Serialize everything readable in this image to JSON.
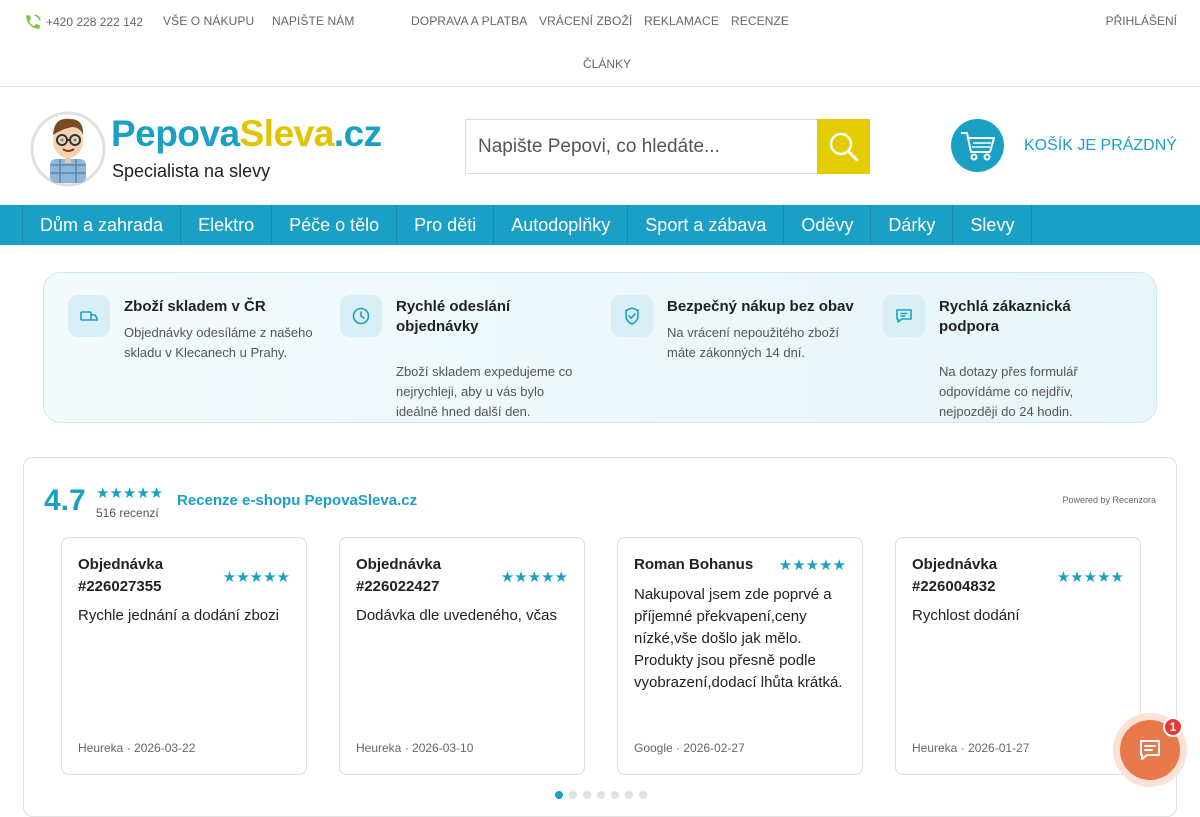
{
  "topbar": {
    "phone": "+420 228 222 142",
    "links": [
      "VŠE O NÁKUPU",
      "NAPIŠTE NÁM",
      "DOPRAVA A PLATBA",
      "VRÁCENÍ ZBOŽÍ",
      "REKLAMACE",
      "RECENZE",
      "ČLÁNKY"
    ],
    "login": "PŘIHLÁŠENÍ"
  },
  "logo": {
    "brand_part1": "Pepova",
    "brand_part2": "Sleva",
    "brand_part3": ".cz",
    "tagline": "Specialista na slevy"
  },
  "search": {
    "placeholder": "Napište Pepovi, co hledáte..."
  },
  "cart": {
    "label": "KOŠÍK JE PRÁZDNÝ"
  },
  "nav": {
    "items": [
      "Dům a zahrada",
      "Elektro",
      "Péče o tělo",
      "Pro děti",
      "Autodoplňky",
      "Sport a zábava",
      "Oděvy",
      "Dárky",
      "Slevy"
    ]
  },
  "benefits": [
    {
      "title": "Zboží skladem v ČR",
      "text": "Objednávky odesíláme z našeho skladu v Klecanech u Prahy.",
      "icon": "truck-icon"
    },
    {
      "title": "Rychlé odeslání objednávky",
      "text": "Zboží skladem expedujeme co nejrychleji, aby u vás bylo ideálně hned další den.",
      "icon": "clock-icon"
    },
    {
      "title": "Bezpečný nákup bez obav",
      "text": "Na vrácení nepoužitého zboží máte zákonných 14 dní.",
      "icon": "shield-check-icon"
    },
    {
      "title": "Rychlá zákaznická podpora",
      "text": "Na dotazy přes formulář odpovídáme co nejdřív, nejpozději do 24 hodin.",
      "icon": "chat-icon"
    }
  ],
  "reviews": {
    "rating": "4.7",
    "stars": "★★★★★",
    "count": "516 recenzí",
    "title": "Recenze e-shopu PepovaSleva.cz",
    "powered_prefix": "Powered by ",
    "powered_link": "Recenzora",
    "cards": [
      {
        "name": "Objednávka #226027355",
        "stars": "★★★★★",
        "text": "Rychle jednání a dodání zbozi",
        "source": "Heureka · 2026-03-22"
      },
      {
        "name": "Objednávka #226022427",
        "stars": "★★★★★",
        "text": "Dodávka dle uvedeného, včas",
        "source": "Heureka · 2026-03-10"
      },
      {
        "name": "Roman Bohanus",
        "stars": "★★★★★",
        "text": "Nakupoval jsem zde poprvé a příjemné překvapení,ceny nízké,vše došlo jak mělo. Produkty jsou přesně podle vyobrazení,dodací lhůta krátká.",
        "source": "Google · 2026-02-27"
      },
      {
        "name": "Objednávka #226004832",
        "stars": "★★★★★",
        "text": "Rychlost dodání",
        "source": "Heureka · 2026-01-27"
      }
    ],
    "active_dot": 1,
    "dot_count": 7
  },
  "chat": {
    "badge": "1"
  },
  "colors": {
    "primary": "#1aa0c5",
    "accent": "#e3cc00",
    "chat": "#e9784b"
  }
}
